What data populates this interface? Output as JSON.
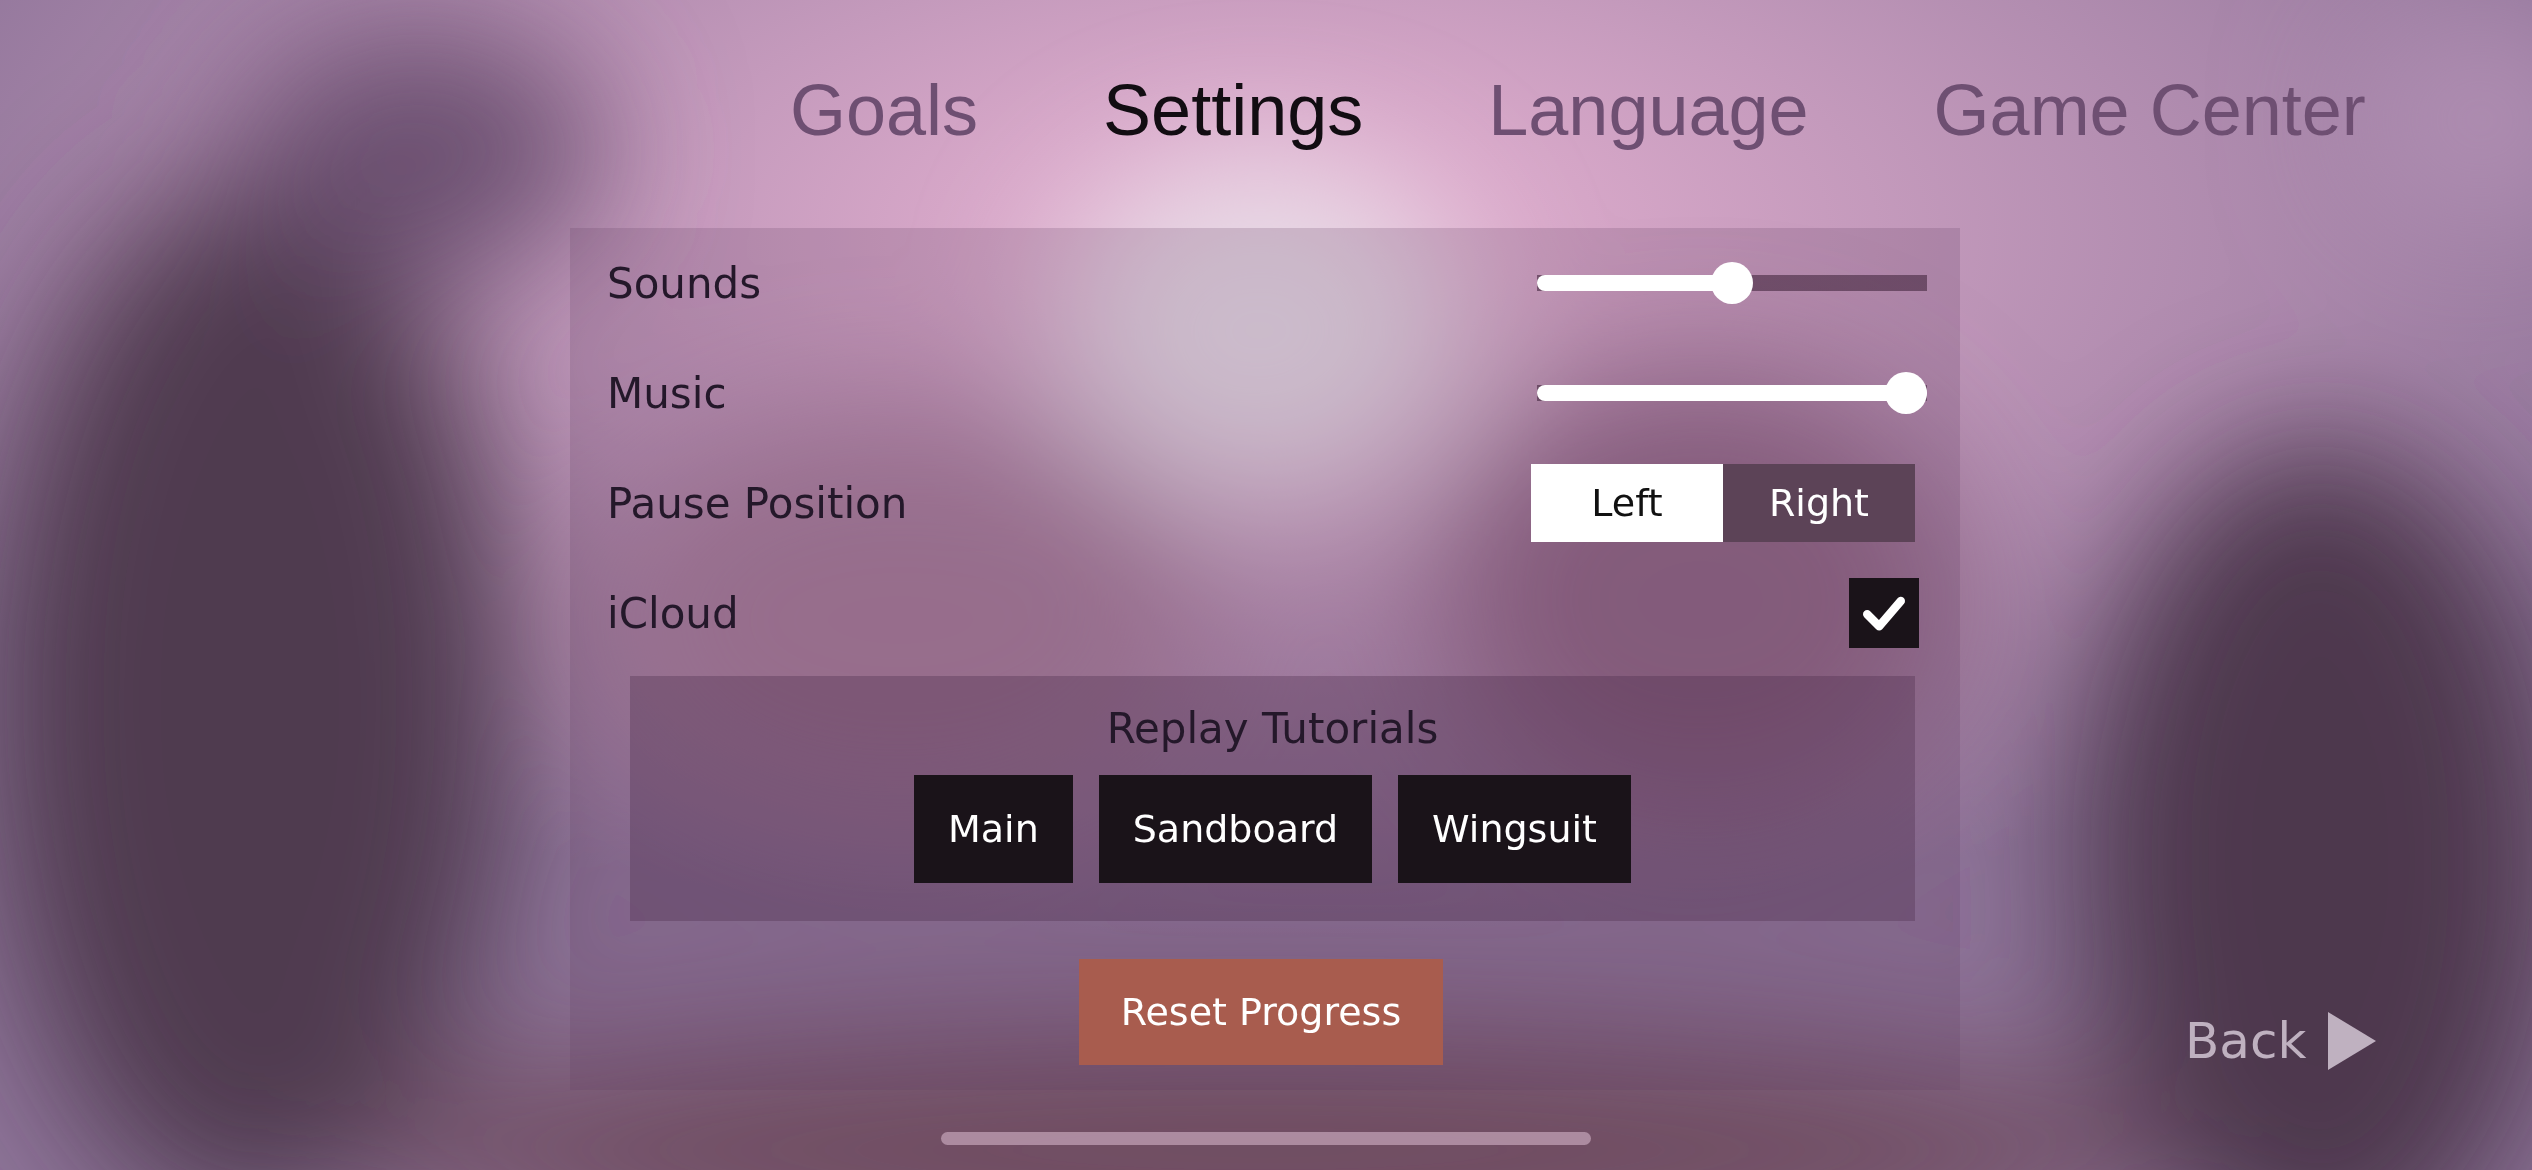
{
  "tabs": [
    {
      "label": "Goals",
      "selected": false
    },
    {
      "label": "Settings",
      "selected": true
    },
    {
      "label": "Language",
      "selected": false
    },
    {
      "label": "Game Center",
      "selected": false
    }
  ],
  "settings": [
    {
      "kind": "slider",
      "label": "Sounds",
      "level": 0.5
    },
    {
      "kind": "slider",
      "label": "Music",
      "level": 1
    },
    {
      "kind": "segmented",
      "label": "Pause Position",
      "options": [
        {
          "label": "Left",
          "selected": true
        },
        {
          "label": "Right",
          "selected": false
        }
      ]
    },
    {
      "kind": "checkbox",
      "label": "iCloud",
      "checked": true
    }
  ],
  "replay_tutorials": {
    "title": "Replay Tutorials",
    "buttons": [
      "Main",
      "Sandboard",
      "Wingsuit"
    ]
  },
  "reset_button": "Reset Progress",
  "back_button": "Back"
}
